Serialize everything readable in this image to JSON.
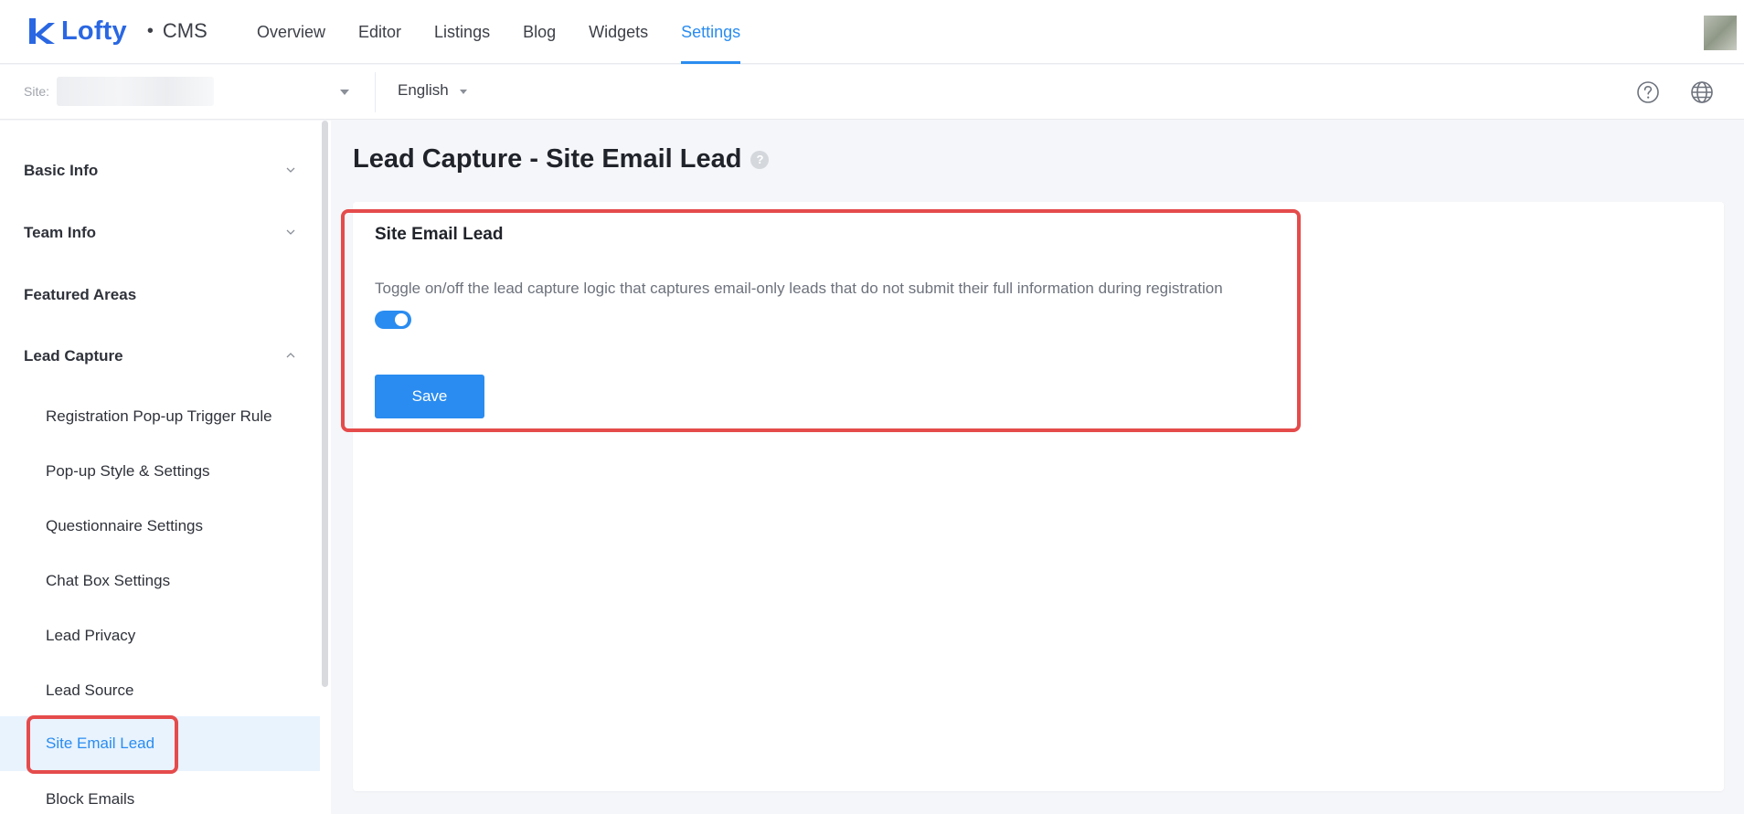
{
  "header": {
    "brand": "Lofty",
    "separator": "•",
    "product": "CMS",
    "nav": [
      {
        "label": "Overview",
        "active": false
      },
      {
        "label": "Editor",
        "active": false
      },
      {
        "label": "Listings",
        "active": false
      },
      {
        "label": "Blog",
        "active": false
      },
      {
        "label": "Widgets",
        "active": false
      },
      {
        "label": "Settings",
        "active": true
      }
    ]
  },
  "subbar": {
    "site_label": "Site:",
    "language": "English"
  },
  "sidebar": {
    "groups": {
      "basic_info": "Basic Info",
      "team_info": "Team Info",
      "featured_areas": "Featured Areas",
      "lead_capture": "Lead Capture"
    },
    "lead_capture_items": [
      "Registration Pop-up Trigger Rule",
      "Pop-up Style & Settings",
      "Questionnaire Settings",
      "Chat Box Settings",
      "Lead Privacy",
      "Lead Source",
      "Site Email Lead",
      "Block Emails"
    ],
    "active_item": "Site Email Lead"
  },
  "main": {
    "page_title": "Lead Capture - Site Email Lead",
    "help_mark": "?",
    "section_title": "Site Email Lead",
    "section_description": "Toggle on/off the lead capture logic that captures email-only leads that do not submit their full information during registration",
    "toggle_on": true,
    "save_label": "Save"
  },
  "colors": {
    "accent": "#2a8cf0",
    "brand": "#2a67e2",
    "highlight": "#e54b4b"
  }
}
